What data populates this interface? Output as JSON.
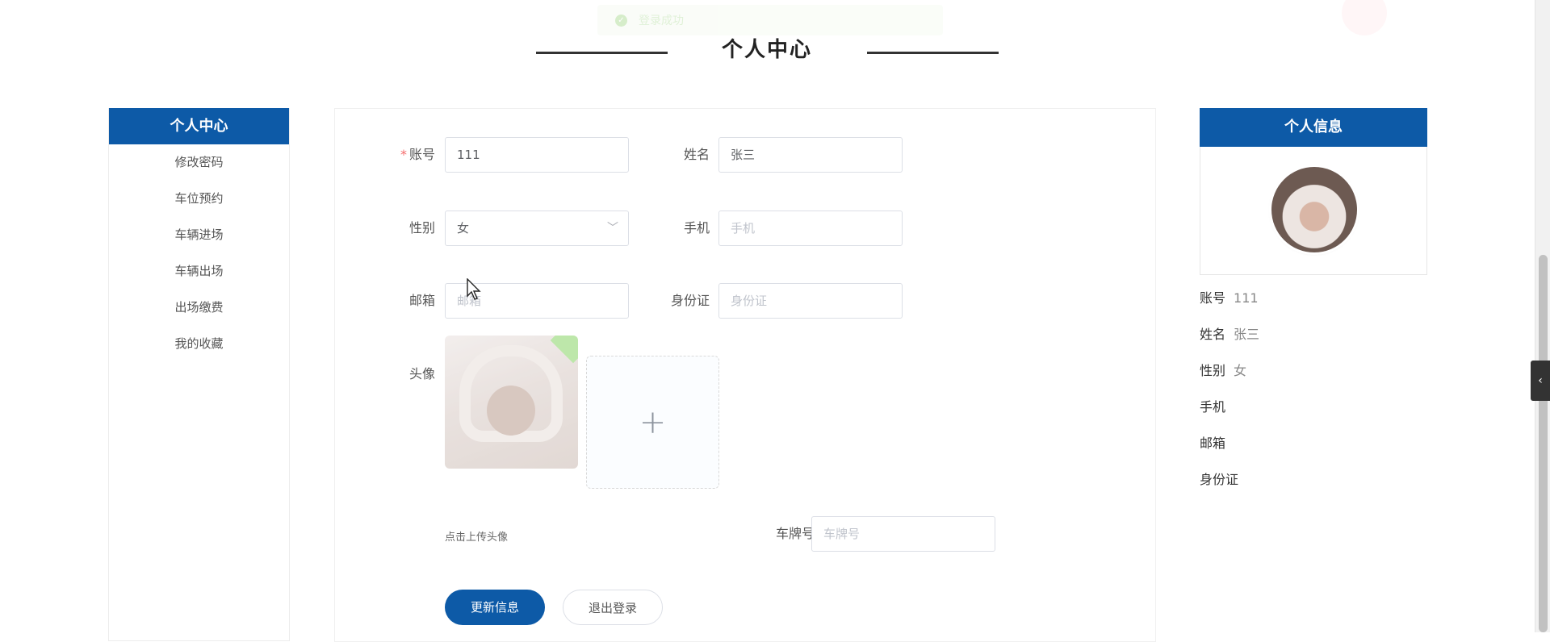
{
  "toast": {
    "text": "登录成功"
  },
  "page": {
    "title": "个人中心"
  },
  "side_menu": {
    "title": "个人中心",
    "items": [
      "修改密码",
      "车位预约",
      "车辆进场",
      "车辆出场",
      "出场缴费",
      "我的收藏"
    ]
  },
  "form": {
    "account": {
      "label": "账号",
      "value": "111"
    },
    "name": {
      "label": "姓名",
      "value": "张三"
    },
    "gender": {
      "label": "性别",
      "value": "女"
    },
    "phone": {
      "label": "手机",
      "placeholder": "手机"
    },
    "email": {
      "label": "邮箱",
      "placeholder": "邮箱"
    },
    "id_card": {
      "label": "身份证",
      "placeholder": "身份证"
    },
    "avatar": {
      "label": "头像",
      "hint": "点击上传头像",
      "add_symbol": "+"
    },
    "plate": {
      "label": "车牌号",
      "placeholder": "车牌号"
    },
    "update_button": "更新信息",
    "logout_button": "退出登录"
  },
  "info_card": {
    "title": "个人信息",
    "fields": [
      {
        "label": "账号",
        "value": "111"
      },
      {
        "label": "姓名",
        "value": "张三"
      },
      {
        "label": "性别",
        "value": "女"
      },
      {
        "label": "手机",
        "value": ""
      },
      {
        "label": "邮箱",
        "value": ""
      },
      {
        "label": "身份证",
        "value": ""
      }
    ]
  },
  "colors": {
    "primary": "#0d5aa7",
    "required": "#f56c6c",
    "success": "#67c23a"
  },
  "icons": {
    "toast": "check-circle-icon",
    "select": "chevron-down-icon",
    "side_tab": "chevron-left-icon",
    "upload": "plus-icon"
  }
}
